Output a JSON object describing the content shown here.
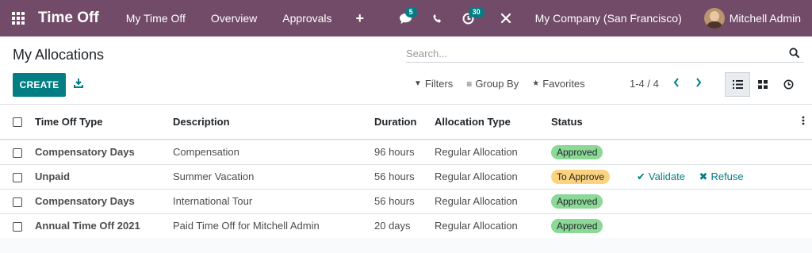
{
  "navbar": {
    "app_title": "Time Off",
    "menu": [
      "My Time Off",
      "Overview",
      "Approvals"
    ],
    "plus": "+",
    "messages_badge": "5",
    "activity_badge": "30",
    "company": "My Company (San Francisco)",
    "user_name": "Mitchell Admin",
    "color": "#714B67"
  },
  "control_panel": {
    "title": "My Allocations",
    "search_placeholder": "Search...",
    "create_label": "CREATE",
    "filters_label": "Filters",
    "group_by_label": "Group By",
    "favorites_label": "Favorites",
    "pager": "1-4 / 4",
    "accent": "#017E84"
  },
  "table": {
    "headers": {
      "type": "Time Off Type",
      "description": "Description",
      "duration": "Duration",
      "allocation_type": "Allocation Type",
      "status": "Status"
    },
    "rows": [
      {
        "type": "Compensatory Days",
        "description": "Compensation",
        "duration": "96 hours",
        "allocation_type": "Regular Allocation",
        "status": "Approved"
      },
      {
        "type": "Unpaid",
        "description": "Summer Vacation",
        "duration": "56 hours",
        "allocation_type": "Regular Allocation",
        "status": "To Approve",
        "validate": "Validate",
        "refuse": "Refuse"
      },
      {
        "type": "Compensatory Days",
        "description": "International Tour",
        "duration": "56 hours",
        "allocation_type": "Regular Allocation",
        "status": "Approved"
      },
      {
        "type": "Annual Time Off 2021",
        "description": "Paid Time Off for Mitchell Admin",
        "duration": "20 days",
        "allocation_type": "Regular Allocation",
        "status": "Approved"
      }
    ]
  }
}
